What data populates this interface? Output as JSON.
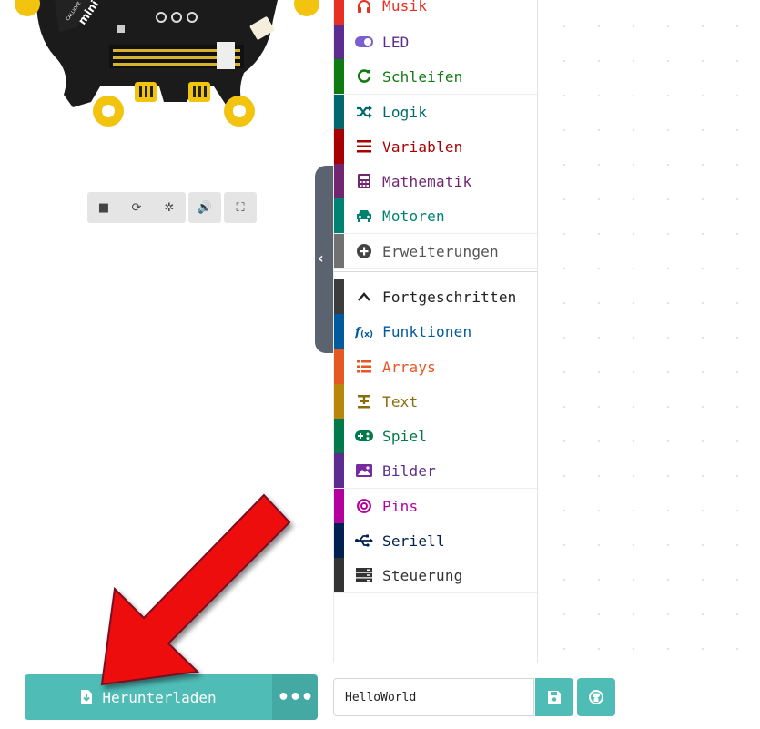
{
  "toolbox": {
    "categories": [
      {
        "label": "Musik",
        "color": "#e63022",
        "icon": "headphones-icon"
      },
      {
        "label": "LED",
        "color": "#5c2d91",
        "icon": "toggle-icon"
      },
      {
        "label": "Schleifen",
        "color": "#107c10",
        "icon": "refresh-icon"
      },
      {
        "label": "Logik",
        "color": "#006970",
        "icon": "shuffle-icon"
      },
      {
        "label": "Variablen",
        "color": "#a80000",
        "icon": "list-icon"
      },
      {
        "label": "Mathematik",
        "color": "#712672",
        "icon": "calculator-icon"
      },
      {
        "label": "Motoren",
        "color": "#008272",
        "icon": "car-icon"
      },
      {
        "label": "Erweiterungen",
        "color": "#717171",
        "icon": "plus-circle-icon"
      },
      {
        "label": "Fortgeschritten",
        "color": "#3c3c3c",
        "icon": "chevron-up-icon"
      },
      {
        "label": "Funktionen",
        "color": "#005a9e",
        "icon": "function-icon"
      },
      {
        "label": "Arrays",
        "color": "#e65722",
        "icon": "array-list-icon"
      },
      {
        "label": "Text",
        "color": "#b8860b",
        "icon": "text-icon"
      },
      {
        "label": "Spiel",
        "color": "#007a4b",
        "icon": "gamepad-icon"
      },
      {
        "label": "Bilder",
        "color": "#5c2d91",
        "icon": "image-icon"
      },
      {
        "label": "Pins",
        "color": "#b4009e",
        "icon": "target-icon"
      },
      {
        "label": "Seriell",
        "color": "#002050",
        "icon": "usb-icon"
      },
      {
        "label": "Steuerung",
        "color": "#333333",
        "icon": "server-icon"
      }
    ]
  },
  "bottom": {
    "download_label": "Herunterladen",
    "more_label": "•••",
    "project_name": "HelloWorld"
  },
  "colors": {
    "accent": "#4fbcb6",
    "accent_dark": "#45a9a3",
    "arrow": "#ee1111"
  }
}
